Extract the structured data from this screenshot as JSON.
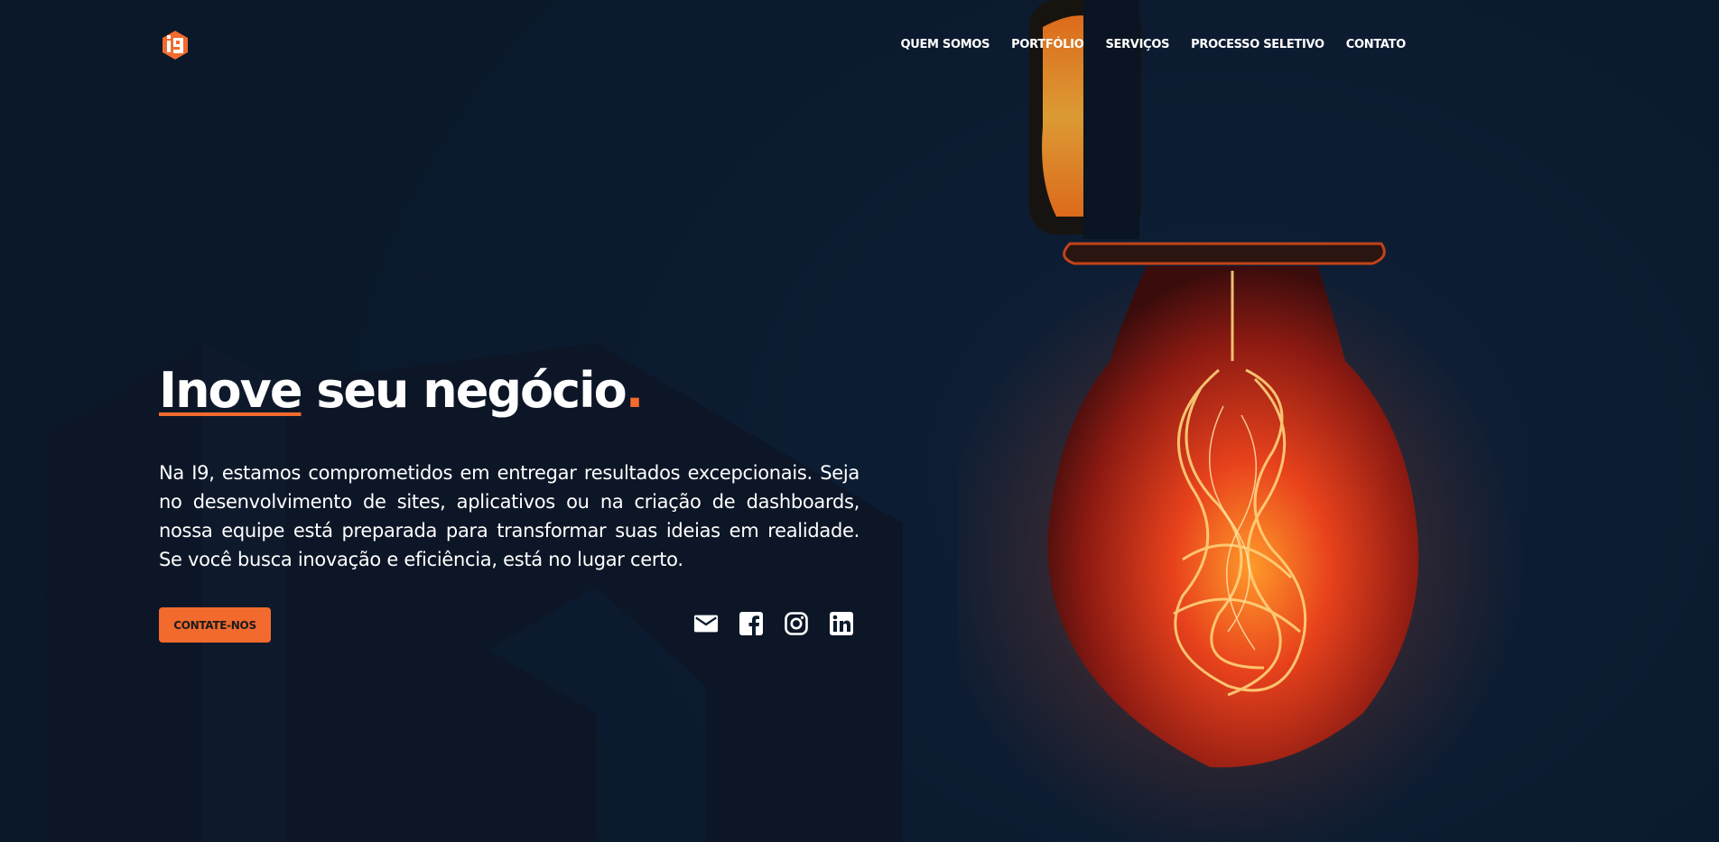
{
  "brand": {
    "logo_text": "i9",
    "accent_color": "#f26a2e"
  },
  "nav": {
    "items": [
      {
        "label": "QUEM SOMOS"
      },
      {
        "label": "PORTFÓLIO"
      },
      {
        "label": "SERVIÇOS"
      },
      {
        "label": "PROCESSO SELETIVO"
      },
      {
        "label": "CONTATO"
      }
    ]
  },
  "hero": {
    "headline_highlight": "Inove",
    "headline_rest": " seu negócio",
    "headline_dot": ".",
    "intro": "Na I9, estamos comprometidos em entregar resultados excepcionais. Seja no desenvolvimento de sites, aplicativos ou na criação de dashboards, nossa equipe está preparada para transformar suas ideias em realidade. Se você busca inovação e eficiência, está no lugar certo.",
    "cta_label": "CONTATE-NOS"
  },
  "social": {
    "icons": [
      "email-icon",
      "facebook-icon",
      "instagram-icon",
      "linkedin-icon"
    ]
  }
}
